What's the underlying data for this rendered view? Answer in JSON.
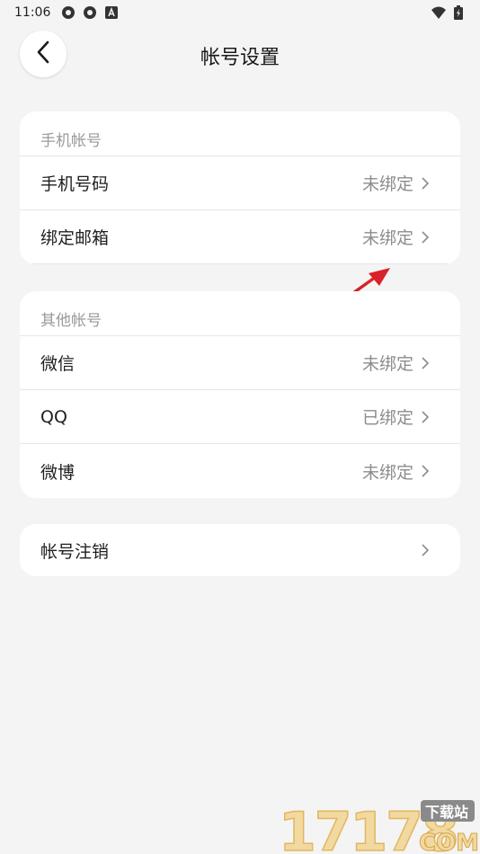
{
  "status_bar": {
    "time": "11:06",
    "icons": [
      "notification-icon",
      "notification-icon",
      "a-icon"
    ],
    "right_icons": [
      "wifi-icon",
      "battery-icon"
    ]
  },
  "header": {
    "title": "帐号设置"
  },
  "sections": [
    {
      "title": "手机帐号",
      "rows": [
        {
          "label": "手机号码",
          "value": "未绑定"
        },
        {
          "label": "绑定邮箱",
          "value": "未绑定"
        }
      ]
    },
    {
      "title": "其他帐号",
      "rows": [
        {
          "label": "微信",
          "value": "未绑定"
        },
        {
          "label": "QQ",
          "value": "已绑定"
        },
        {
          "label": "微博",
          "value": "未绑定"
        }
      ]
    },
    {
      "rows": [
        {
          "label": "帐号注销",
          "value": ""
        }
      ]
    }
  ],
  "watermark": {
    "text": "17178",
    "sub": "下载站",
    "domain": "COM"
  },
  "colors": {
    "background": "#f4f4f4",
    "card": "#ffffff",
    "muted_text": "#8c8c8c",
    "annotation_arrow": "#d9222a"
  }
}
